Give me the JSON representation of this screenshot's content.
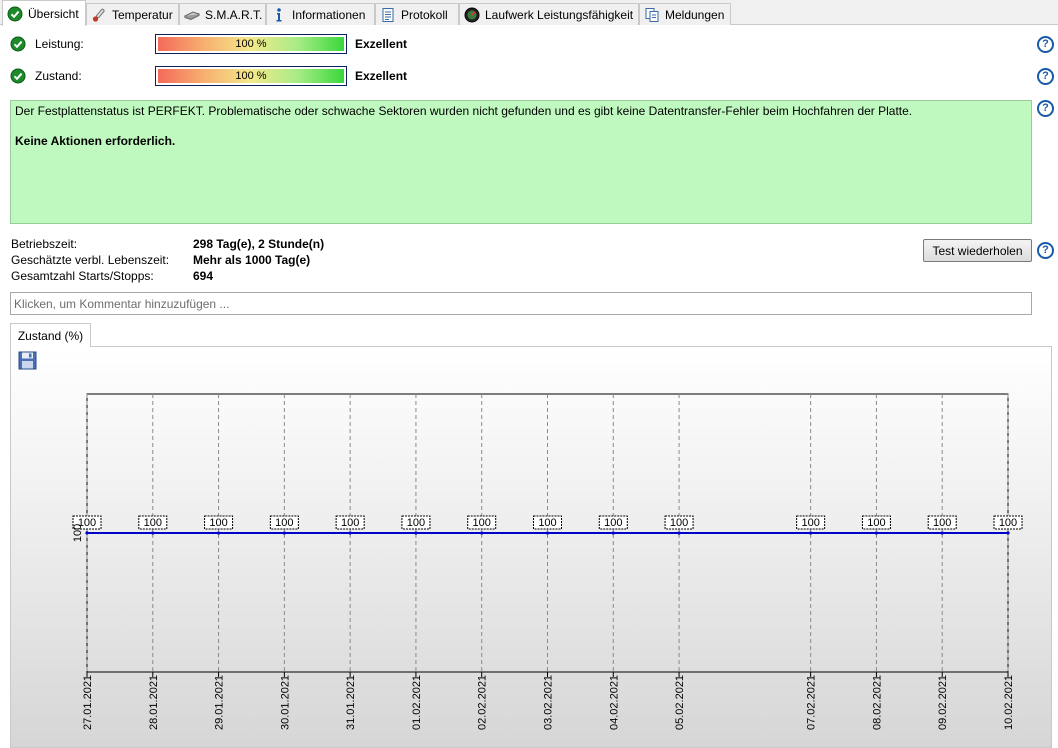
{
  "tabs": [
    {
      "label": "Übersicht",
      "icon": "check-circle-icon"
    },
    {
      "label": "Temperatur",
      "icon": "thermometer-icon"
    },
    {
      "label": "S.M.A.R.T.",
      "icon": "drive-icon"
    },
    {
      "label": "Informationen",
      "icon": "info-icon"
    },
    {
      "label": "Protokoll",
      "icon": "log-document-icon"
    },
    {
      "label": "Laufwerk Leistungsfähigkeit",
      "icon": "speedometer-icon"
    },
    {
      "label": "Meldungen",
      "icon": "messages-icon"
    }
  ],
  "performance": {
    "label": "Leistung:",
    "percent_text": "100 %",
    "value": 100,
    "rating": "Exzellent"
  },
  "health": {
    "label": "Zustand:",
    "percent_text": "100 %",
    "value": 100,
    "rating": "Exzellent"
  },
  "status": {
    "message": "Der Festplattenstatus ist PERFEKT. Problematische oder schwache Sektoren wurden nicht gefunden und es gibt keine Datentransfer-Fehler beim Hochfahren der Platte.",
    "action": "Keine Aktionen erforderlich."
  },
  "stats": [
    {
      "label": "Betriebszeit:",
      "value": "298 Tag(e), 2 Stunde(n)"
    },
    {
      "label": "Geschätzte verbl. Lebenszeit:",
      "value": "Mehr als 1000 Tag(e)"
    },
    {
      "label": "Gesamtzahl Starts/Stopps:",
      "value": "694"
    }
  ],
  "retest_button": "Test wiederholen",
  "help_glyph": "?",
  "comment_placeholder": "Klicken, um Kommentar hinzuzufügen ...",
  "chart_tab": "Zustand (%)",
  "colors": {
    "status_bg": "#c0f9c0",
    "series": "#0000c8",
    "help": "#1a5aa8",
    "ok": "#1c8a2a"
  },
  "chart_data": {
    "type": "line",
    "x": [
      "27.01.2021",
      "28.01.2021",
      "29.01.2021",
      "30.01.2021",
      "31.01.2021",
      "01.02.2021",
      "02.02.2021",
      "03.02.2021",
      "04.02.2021",
      "05.02.2021",
      "07.02.2021",
      "08.02.2021",
      "09.02.2021",
      "10.02.2021"
    ],
    "x_days": [
      0,
      1,
      2,
      3,
      4,
      5,
      6,
      7,
      8,
      9,
      11,
      12,
      13,
      14
    ],
    "series": [
      {
        "values": [
          100,
          100,
          100,
          100,
          100,
          100,
          100,
          100,
          100,
          100,
          100,
          100,
          100,
          100
        ]
      }
    ],
    "y_tick": "100",
    "ylim": [
      99,
      101
    ],
    "grid": true,
    "data_labels": true
  }
}
